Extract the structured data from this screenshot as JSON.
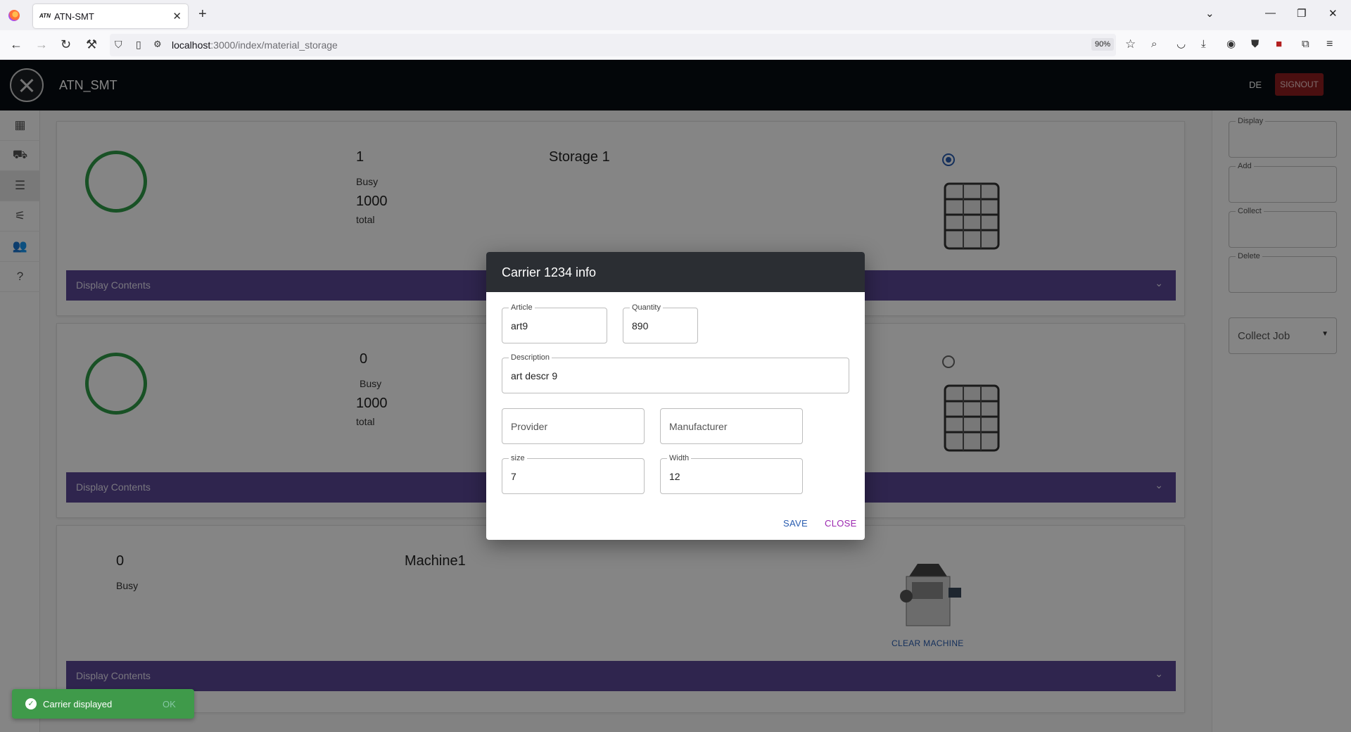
{
  "browser": {
    "tab_title": "ATN-SMT",
    "tab_favicon": "ATN",
    "url_host": "localhost",
    "url_path": ":3000/index/material_storage",
    "zoom": "90%"
  },
  "header": {
    "title": "ATN_SMT",
    "lang_label": "DE",
    "signout_label": "SIGNOUT"
  },
  "sidebar": {
    "items": [
      {
        "icon": "dashboard-icon"
      },
      {
        "icon": "truck-icon"
      },
      {
        "icon": "list-icon"
      },
      {
        "icon": "tune-icon"
      },
      {
        "icon": "people-icon"
      },
      {
        "icon": "help-icon"
      }
    ],
    "active_index": 2
  },
  "cards": [
    {
      "busy_count": "1",
      "busy_label": "Busy",
      "total_count": "1000",
      "total_label": "total",
      "name": "Storage 1",
      "selected": true,
      "contents_label": "Display Contents"
    },
    {
      "busy_count": "0",
      "busy_label": "Busy",
      "total_count": "1000",
      "total_label": "total",
      "name": "",
      "selected": false,
      "contents_label": "Display Contents"
    },
    {
      "busy_count": "0",
      "busy_label": "Busy",
      "name": "Machine1",
      "action_label": "CLEAR MACHINE",
      "contents_label": "Display Contents"
    }
  ],
  "right_panel": {
    "fields": [
      "Display",
      "Add",
      "Collect",
      "Delete"
    ],
    "job_select": "Collect Job"
  },
  "dialog": {
    "title": "Carrier 1234 info",
    "article": {
      "label": "Article",
      "value": "art9"
    },
    "quantity": {
      "label": "Quantity",
      "value": "890"
    },
    "description": {
      "label": "Description",
      "value": "art descr 9"
    },
    "provider": {
      "placeholder": "Provider"
    },
    "manufacturer": {
      "placeholder": "Manufacturer"
    },
    "size": {
      "label": "size",
      "value": "7"
    },
    "width": {
      "label": "Width",
      "value": "12"
    },
    "save_label": "SAVE",
    "close_label": "CLOSE"
  },
  "snackbar": {
    "message": "Carrier displayed",
    "action": "OK"
  },
  "colors": {
    "header_bg": "#070d12",
    "accent_purple": "#5b4796",
    "ring_green": "#2e9b47",
    "signout_red": "#8f1d20",
    "snackbar_green": "#3f9a4a"
  }
}
